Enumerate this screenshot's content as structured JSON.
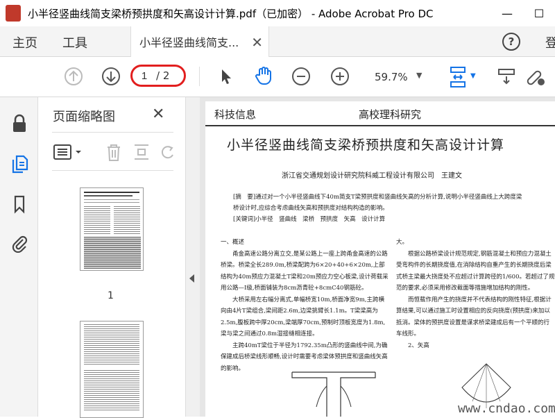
{
  "window": {
    "title": "小半径竖曲线简支梁桥预拱度和矢高设计计算.pdf（已加密） - Adobe Acrobat Pro DC",
    "minimize": "—",
    "maximize": "☐"
  },
  "tabs": {
    "home": "主页",
    "tools": "工具",
    "document": "小半径竖曲线简支...",
    "signin": "登"
  },
  "toolbar": {
    "page_current": "1",
    "page_total": "/ 2",
    "zoom": "59.7%"
  },
  "thumbnail_panel": {
    "title": "页面缩略图",
    "thumb1_label": "1"
  },
  "document": {
    "header_left": "科技信息",
    "header_right": "高校理科研究",
    "title": "小半径竖曲线简支梁桥预拱度和矢高设计计算",
    "author": "浙江省交通规划设计研究院科威工程设计有限公司　王建文",
    "abstract_line1": "[摘　要]通过对一个小半径竖曲线下40m简支T梁预拱度和竖曲线矢高的分析计算,说明小半径竖曲线上大跨度梁",
    "abstract_line2": "桥设计时,应综合考虑曲线矢高和预拱度对结构构造的影响。",
    "keywords": "[关键词]小半径　竖曲线　梁桥　预拱度　矢高　设计计算",
    "section1": "一、概述",
    "p1": "甬金高速公路分离立交,是某公路上一座上跨甬金高速的公路桥梁。桥梁全长289.0m,桥梁配跨为6×20+40+6×20m,上部结构为40m预应力混凝土T梁和20m预应力空心板梁,设计荷载采用公路—I级,桥面铺装为8cm沥青砼+8cmC40钢筋砼。",
    "p2": "大桥采用左右幅分离式,单幅桥宽10m,桥面净宽9m,主跨横向由4片T梁组合,梁间距2.6m,边梁挑臂长1.1m。T梁梁高为2.5m,腹板跨中厚20cm,梁端厚70cm,预制时顶板宽度为1.8m,梁与梁之间通过0.8m湿接缝相连接。",
    "p3": "主跨40mT梁位于半径为1792.35m凸形的竖曲线中间,为确保建成后桥梁线形顺畅,设计时需要考虑梁体预拱度和竖曲线矢高的影响。",
    "c2_p0": "大。",
    "c2_p1": "根据公路桥梁设计规范规定,钢筋混凝土和预应力混凝土受弯构件的长期挠度值,在消除结构自重产生的长期挠度后梁式桥主梁最大挠度处不应超过计算跨径的1/600。若超过了规范的要求,必须采用修改截面等措施增加结构的刚性。",
    "c2_p2": "而恒载作用产生的挠度并不代表结构的刚性特征,根据计算结果,可以通过施工时设置相应的反向挠度(预拱度)来加以抵消。梁体的预拱度设置是谋求桥梁建成后有一个平顺的行车线形。",
    "c2_section": "2、矢高",
    "watermark": "www.cndao.com"
  },
  "colors": {
    "accent_red": "#e21e1e",
    "blue_icon": "#1473e6"
  }
}
